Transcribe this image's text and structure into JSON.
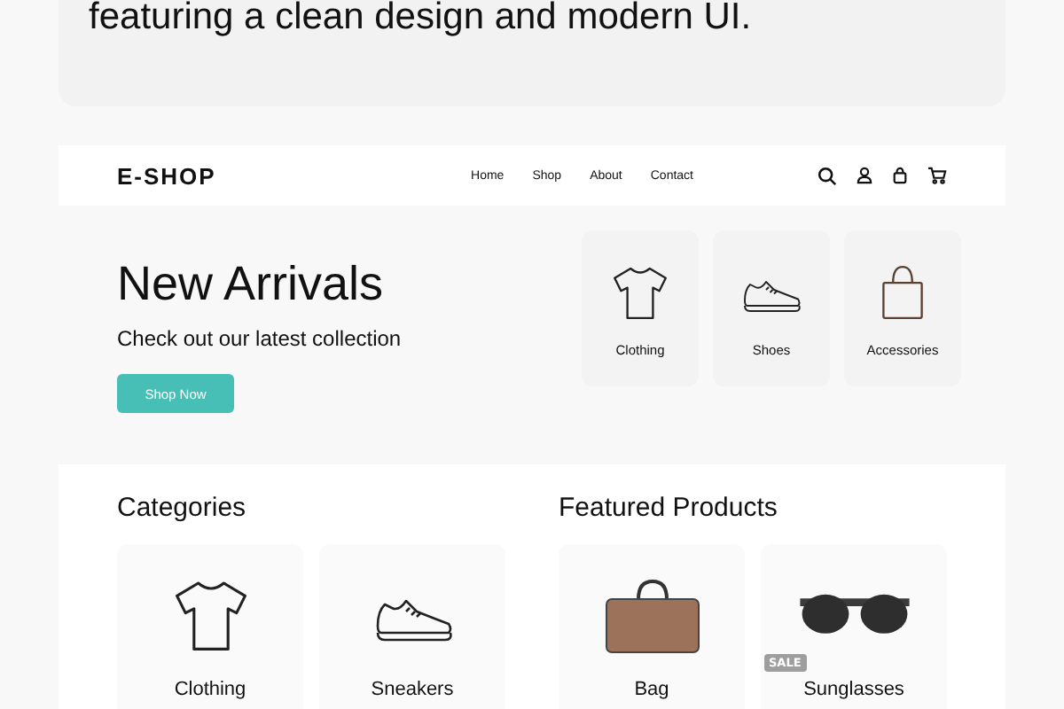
{
  "intro": {
    "text": "featuring a clean design and modern UI."
  },
  "header": {
    "logo": "E-SHOP",
    "nav": [
      "Home",
      "Shop",
      "About",
      "Contact"
    ]
  },
  "hero": {
    "title": "New Arrivals",
    "subtitle": "Check out our latest collection",
    "button": "Shop Now",
    "tiles": [
      {
        "kind": "shirt",
        "label": "Clothing"
      },
      {
        "kind": "shoe",
        "label": "Shoes"
      },
      {
        "kind": "bag",
        "label": "Accessories"
      }
    ]
  },
  "categories": {
    "title": "Categories",
    "items": [
      {
        "kind": "shirt",
        "label": "Clothing"
      },
      {
        "kind": "shoe",
        "label": "Sneakers"
      }
    ]
  },
  "featured": {
    "title": "Featured Products",
    "items": [
      {
        "kind": "bag",
        "label": "Bag"
      },
      {
        "kind": "sunglasses",
        "label": "Sunglasses",
        "badge": "SALE"
      }
    ]
  }
}
